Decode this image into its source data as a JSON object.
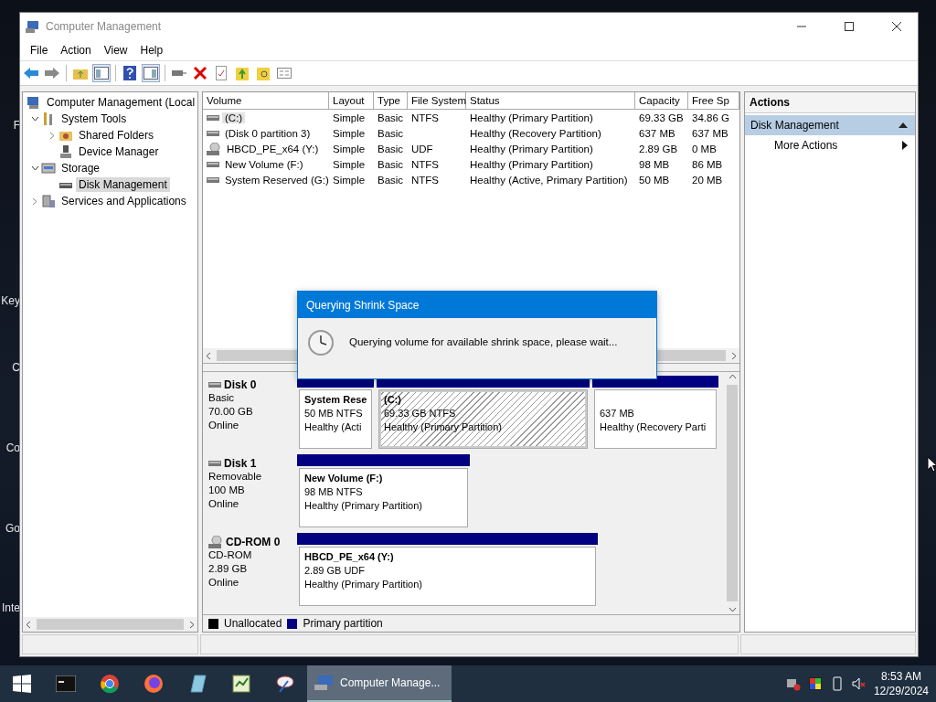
{
  "desktop_labels": [
    "F",
    "Key",
    "C",
    "Co",
    "Go",
    "Inte"
  ],
  "window": {
    "title": "Computer Management"
  },
  "menu": [
    "File",
    "Action",
    "View",
    "Help"
  ],
  "tree": [
    {
      "label": "Computer Management (Local",
      "children": [
        {
          "label": "System Tools",
          "expanded": true,
          "selected": false,
          "children": [
            {
              "label": "Shared Folders",
              "expanded": false,
              "selected": false
            },
            {
              "label": "Device Manager",
              "selected": false
            }
          ]
        },
        {
          "label": "Storage",
          "expanded": true,
          "selected": false,
          "children": [
            {
              "label": "Disk Management",
              "selected": true
            }
          ]
        },
        {
          "label": "Services and Applications",
          "expanded": false,
          "selected": false
        }
      ],
      "selected": false
    }
  ],
  "table": {
    "columns": [
      "Volume",
      "Layout",
      "Type",
      "File System",
      "Status",
      "Capacity",
      "Free Sp"
    ],
    "rows": [
      {
        "kind": "disk",
        "selected": true,
        "cells": [
          "(C:)",
          "Simple",
          "Basic",
          "NTFS",
          "Healthy (Primary Partition)",
          "69.33 GB",
          "34.86 G"
        ]
      },
      {
        "kind": "disk",
        "selected": false,
        "cells": [
          "(Disk 0 partition 3)",
          "Simple",
          "Basic",
          "",
          "Healthy (Recovery Partition)",
          "637 MB",
          "637 MB"
        ]
      },
      {
        "kind": "cdrom",
        "selected": false,
        "cells": [
          "HBCD_PE_x64 (Y:)",
          "Simple",
          "Basic",
          "UDF",
          "Healthy (Primary Partition)",
          "2.89 GB",
          "0 MB"
        ]
      },
      {
        "kind": "disk",
        "selected": false,
        "cells": [
          "New Volume (F:)",
          "Simple",
          "Basic",
          "NTFS",
          "Healthy (Primary Partition)",
          "98 MB",
          "86 MB"
        ]
      },
      {
        "kind": "disk",
        "selected": false,
        "cells": [
          "System Reserved (G:)",
          "Simple",
          "Basic",
          "NTFS",
          "Healthy (Active, Primary Partition)",
          "50 MB",
          "20 MB"
        ]
      }
    ]
  },
  "disks": [
    {
      "kind": "disk",
      "name": "Disk 0",
      "type": "Basic",
      "size": "70.00 GB",
      "status": "Online",
      "partitions": [
        {
          "title": "System Rese",
          "size": "50 MB NTFS",
          "status": "Healthy (Acti",
          "selected": false
        },
        {
          "title": "(C:)",
          "size": "69.33 GB NTFS",
          "status": "Healthy (Primary Partition)",
          "selected": true
        },
        {
          "size": "637 MB",
          "status": "Healthy (Recovery Parti",
          "selected": false
        }
      ]
    },
    {
      "kind": "disk",
      "name": "Disk 1",
      "type": "Removable",
      "size": "100 MB",
      "status": "Online",
      "partitions": [
        {
          "title": "New Volume  (F:)",
          "size": "98 MB NTFS",
          "status": "Healthy (Primary Partition)",
          "selected": false
        }
      ]
    },
    {
      "kind": "cdrom",
      "name": "CD-ROM 0",
      "type": "CD-ROM",
      "size": "2.89 GB",
      "status": "Online",
      "partitions": [
        {
          "title": "HBCD_PE_x64  (Y:)",
          "size": "2.89 GB UDF",
          "status": "Healthy (Primary Partition)",
          "selected": false
        }
      ]
    }
  ],
  "legend": [
    {
      "label": "Unallocated",
      "color": "#000000"
    },
    {
      "label": "Primary partition",
      "color": "#000080"
    }
  ],
  "actions": {
    "title": "Actions",
    "section": {
      "label": "Disk Management",
      "expanded": true
    },
    "items": [
      "More Actions"
    ]
  },
  "dialog": {
    "title": "Querying Shrink Space",
    "message": "Querying volume for available shrink space, please wait..."
  },
  "taskbar": {
    "apps": [
      {
        "kind": "terminal"
      },
      {
        "kind": "chrome"
      },
      {
        "kind": "firefox"
      },
      {
        "kind": "notepad"
      },
      {
        "kind": "sheet"
      },
      {
        "kind": "tool"
      }
    ],
    "window_button": {
      "label": "Computer Manage...",
      "selected": true
    },
    "time": "8:53 AM",
    "date": "12/29/2024"
  }
}
